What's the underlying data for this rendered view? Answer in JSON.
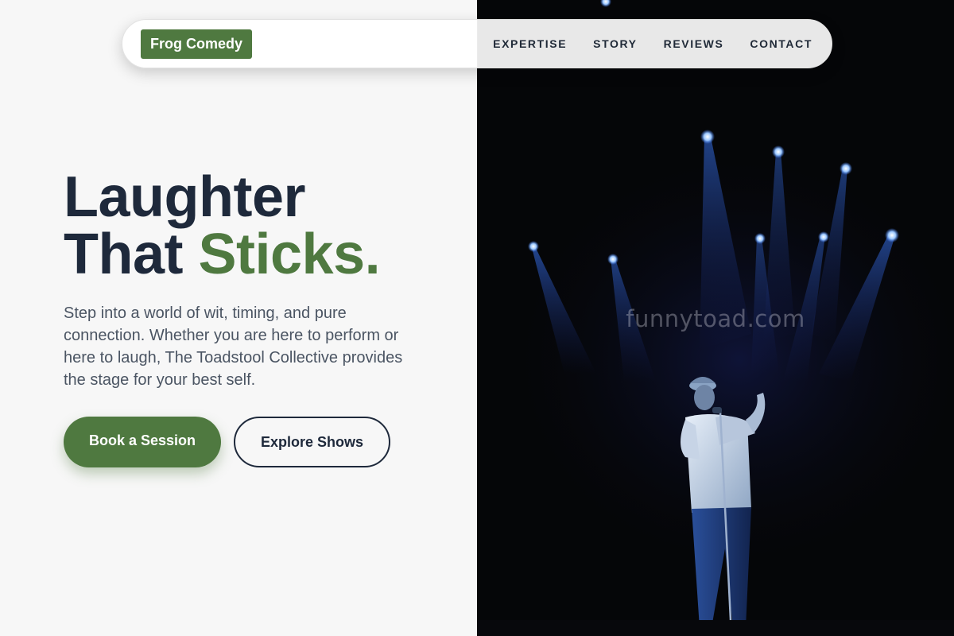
{
  "brand": {
    "logo_text": "Frog Comedy",
    "accent_color": "#4f7940",
    "dark_color": "#1e293b"
  },
  "nav": {
    "links": [
      {
        "label": "EXPERTISE"
      },
      {
        "label": "STORY"
      },
      {
        "label": "REVIEWS"
      },
      {
        "label": "CONTACT"
      }
    ]
  },
  "hero": {
    "headline_line1": "Laughter",
    "headline_line2_plain": "That ",
    "headline_line2_accent": "Sticks.",
    "lead": "Step into a world of wit, timing, and pure connection. Whether you are here to perform or here to laugh, The Toadstool Collective provides the stage for your best self.",
    "primary_button": "Book a Session",
    "secondary_button": "Explore Shows"
  },
  "image": {
    "description_icon": "comedian-on-stage-photo",
    "watermark": "funnytoad.com"
  }
}
